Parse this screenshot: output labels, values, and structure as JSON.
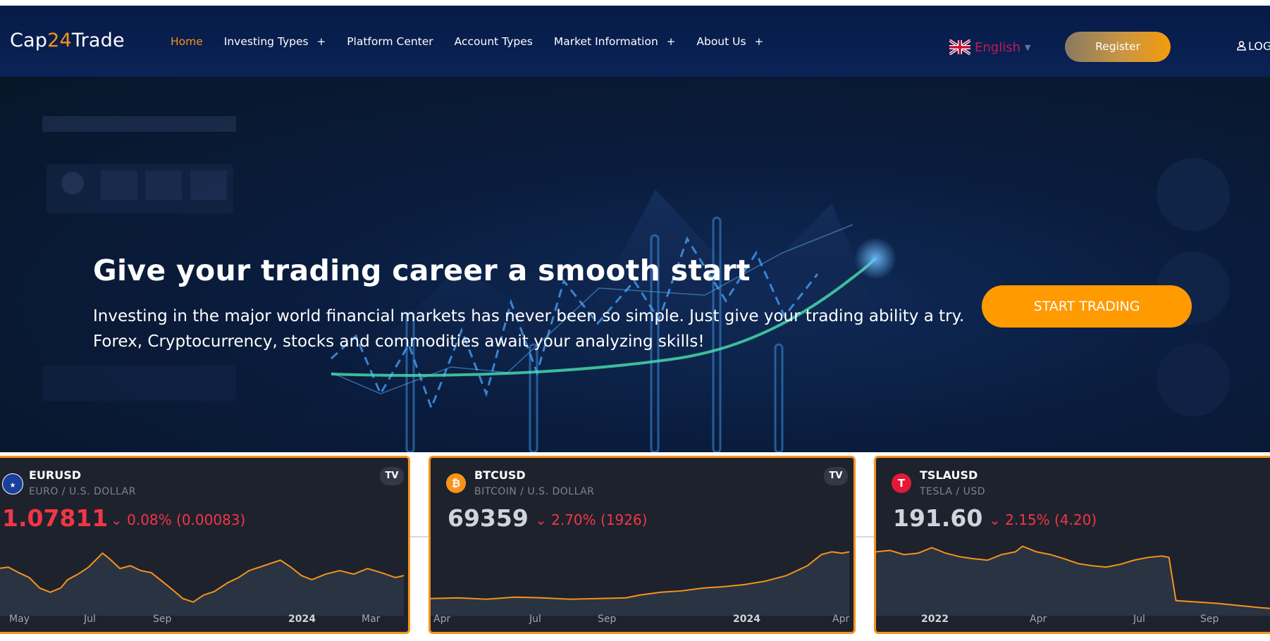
{
  "brand": {
    "part1": "Cap",
    "accent": "24",
    "part2": "Trade"
  },
  "nav": {
    "items": [
      {
        "label": "Home",
        "has_plus": false,
        "active": true
      },
      {
        "label": "Investing Types",
        "has_plus": true
      },
      {
        "label": "Platform Center",
        "has_plus": false
      },
      {
        "label": "Account Types",
        "has_plus": false
      },
      {
        "label": "Market Information",
        "has_plus": true
      },
      {
        "label": "About Us",
        "has_plus": true
      }
    ],
    "plus_glyph": "+",
    "language": "English",
    "register": "Register",
    "login": "LOG"
  },
  "hero": {
    "title": "Give your trading career a smooth start",
    "subtitle": "Investing in the major world financial markets has never been so simple. Just give your trading ability a try. Forex, Cryptocurrency, stocks and commodities await your analyzing skills!",
    "cta": "START TRADING"
  },
  "tickers": [
    {
      "symbol": "EURUSD",
      "description": "EURO / U.S. DOLLAR",
      "price": "1.07811",
      "price_color": "#f23645",
      "change": "0.08% (0.00083)",
      "axis": [
        {
          "label": "May",
          "bold": false
        },
        {
          "label": "Jul",
          "bold": false
        },
        {
          "label": "Sep",
          "bold": false
        },
        {
          "label": "2024",
          "bold": true
        },
        {
          "label": "Mar",
          "bold": false
        }
      ],
      "icon": "eu-us-flag-icon"
    },
    {
      "symbol": "BTCUSD",
      "description": "BITCOIN / U.S. DOLLAR",
      "price": "69359",
      "price_color": "#d1d4dc",
      "change": "2.70% (1926)",
      "axis": [
        {
          "label": "Apr",
          "bold": false
        },
        {
          "label": "Jul",
          "bold": false
        },
        {
          "label": "Sep",
          "bold": false
        },
        {
          "label": "2024",
          "bold": true
        },
        {
          "label": "Apr",
          "bold": false
        }
      ],
      "icon": "bitcoin-icon"
    },
    {
      "symbol": "TSLAUSD",
      "description": "TESLA / USD",
      "price": "191.60",
      "price_color": "#d1d4dc",
      "change": "2.15% (4.20)",
      "axis": [
        {
          "label": "2022",
          "bold": true
        },
        {
          "label": "Apr",
          "bold": false
        },
        {
          "label": "Jul",
          "bold": false
        },
        {
          "label": "Sep",
          "bold": false
        }
      ],
      "icon": "tesla-icon"
    }
  ],
  "colors": {
    "accent": "#f7931a",
    "cta": "#ff9a00",
    "down": "#f23645",
    "navbar": "#061a46",
    "card": "#1e222d"
  }
}
